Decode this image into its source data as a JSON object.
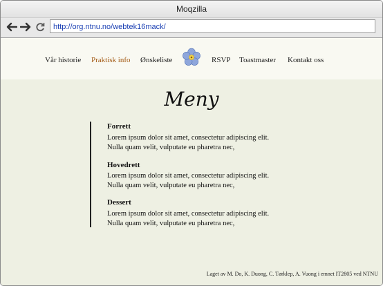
{
  "window": {
    "title": "Moqzilla"
  },
  "browser": {
    "url": "http://org.ntnu.no/webtek16mack/"
  },
  "nav": {
    "items": [
      {
        "label": "Vår historie"
      },
      {
        "label": "Praktisk info",
        "active": true
      },
      {
        "label": "Ønskeliste"
      },
      {
        "label": "RSVP"
      },
      {
        "label": "Toastmaster"
      },
      {
        "label": "Kontakt oss"
      }
    ],
    "logo_icon": "forget-me-not-flower-icon"
  },
  "main": {
    "title": "Meny",
    "courses": [
      {
        "name": "Forrett",
        "text": "Lorem ipsum dolor sit amet, consectetur adipiscing elit. Nulla quam velit, vulputate eu pharetra nec,"
      },
      {
        "name": "Hovedrett",
        "text": "Lorem ipsum dolor sit amet, consectetur adipiscing elit. Nulla quam velit, vulputate eu pharetra nec,"
      },
      {
        "name": "Dessert",
        "text": "Lorem ipsum dolor sit amet, consectetur adipiscing elit. Nulla quam velit, vulputate eu pharetra nec,"
      }
    ]
  },
  "footer": {
    "text": "Laget av M. Do, K. Duong, C. Tørklep, A. Vuong i emnet IT2805 ved NTNU"
  },
  "colors": {
    "accent": "#a35a14",
    "page_bg": "#eef0e3",
    "nav_bg": "#f9f9f2"
  }
}
